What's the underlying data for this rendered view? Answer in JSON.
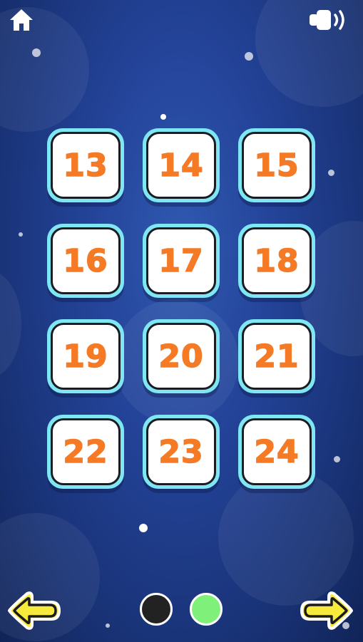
{
  "header": {
    "home_icon": "home-icon",
    "sound_icon": "speaker-on-icon"
  },
  "levels": [
    {
      "number": "13"
    },
    {
      "number": "14"
    },
    {
      "number": "15"
    },
    {
      "number": "16"
    },
    {
      "number": "17"
    },
    {
      "number": "18"
    },
    {
      "number": "19"
    },
    {
      "number": "20"
    },
    {
      "number": "21"
    },
    {
      "number": "22"
    },
    {
      "number": "23"
    },
    {
      "number": "24"
    }
  ],
  "pagination": {
    "prev_icon": "arrow-left-icon",
    "next_icon": "arrow-right-icon",
    "pages": [
      {
        "state": "inactive"
      },
      {
        "state": "active"
      }
    ]
  },
  "colors": {
    "background": "#24449a",
    "tile_border": "#7fe7f4",
    "number": "#f47a26",
    "arrow": "#f6ea3c",
    "page_inactive": "#222222",
    "page_active": "#7ff07a"
  }
}
